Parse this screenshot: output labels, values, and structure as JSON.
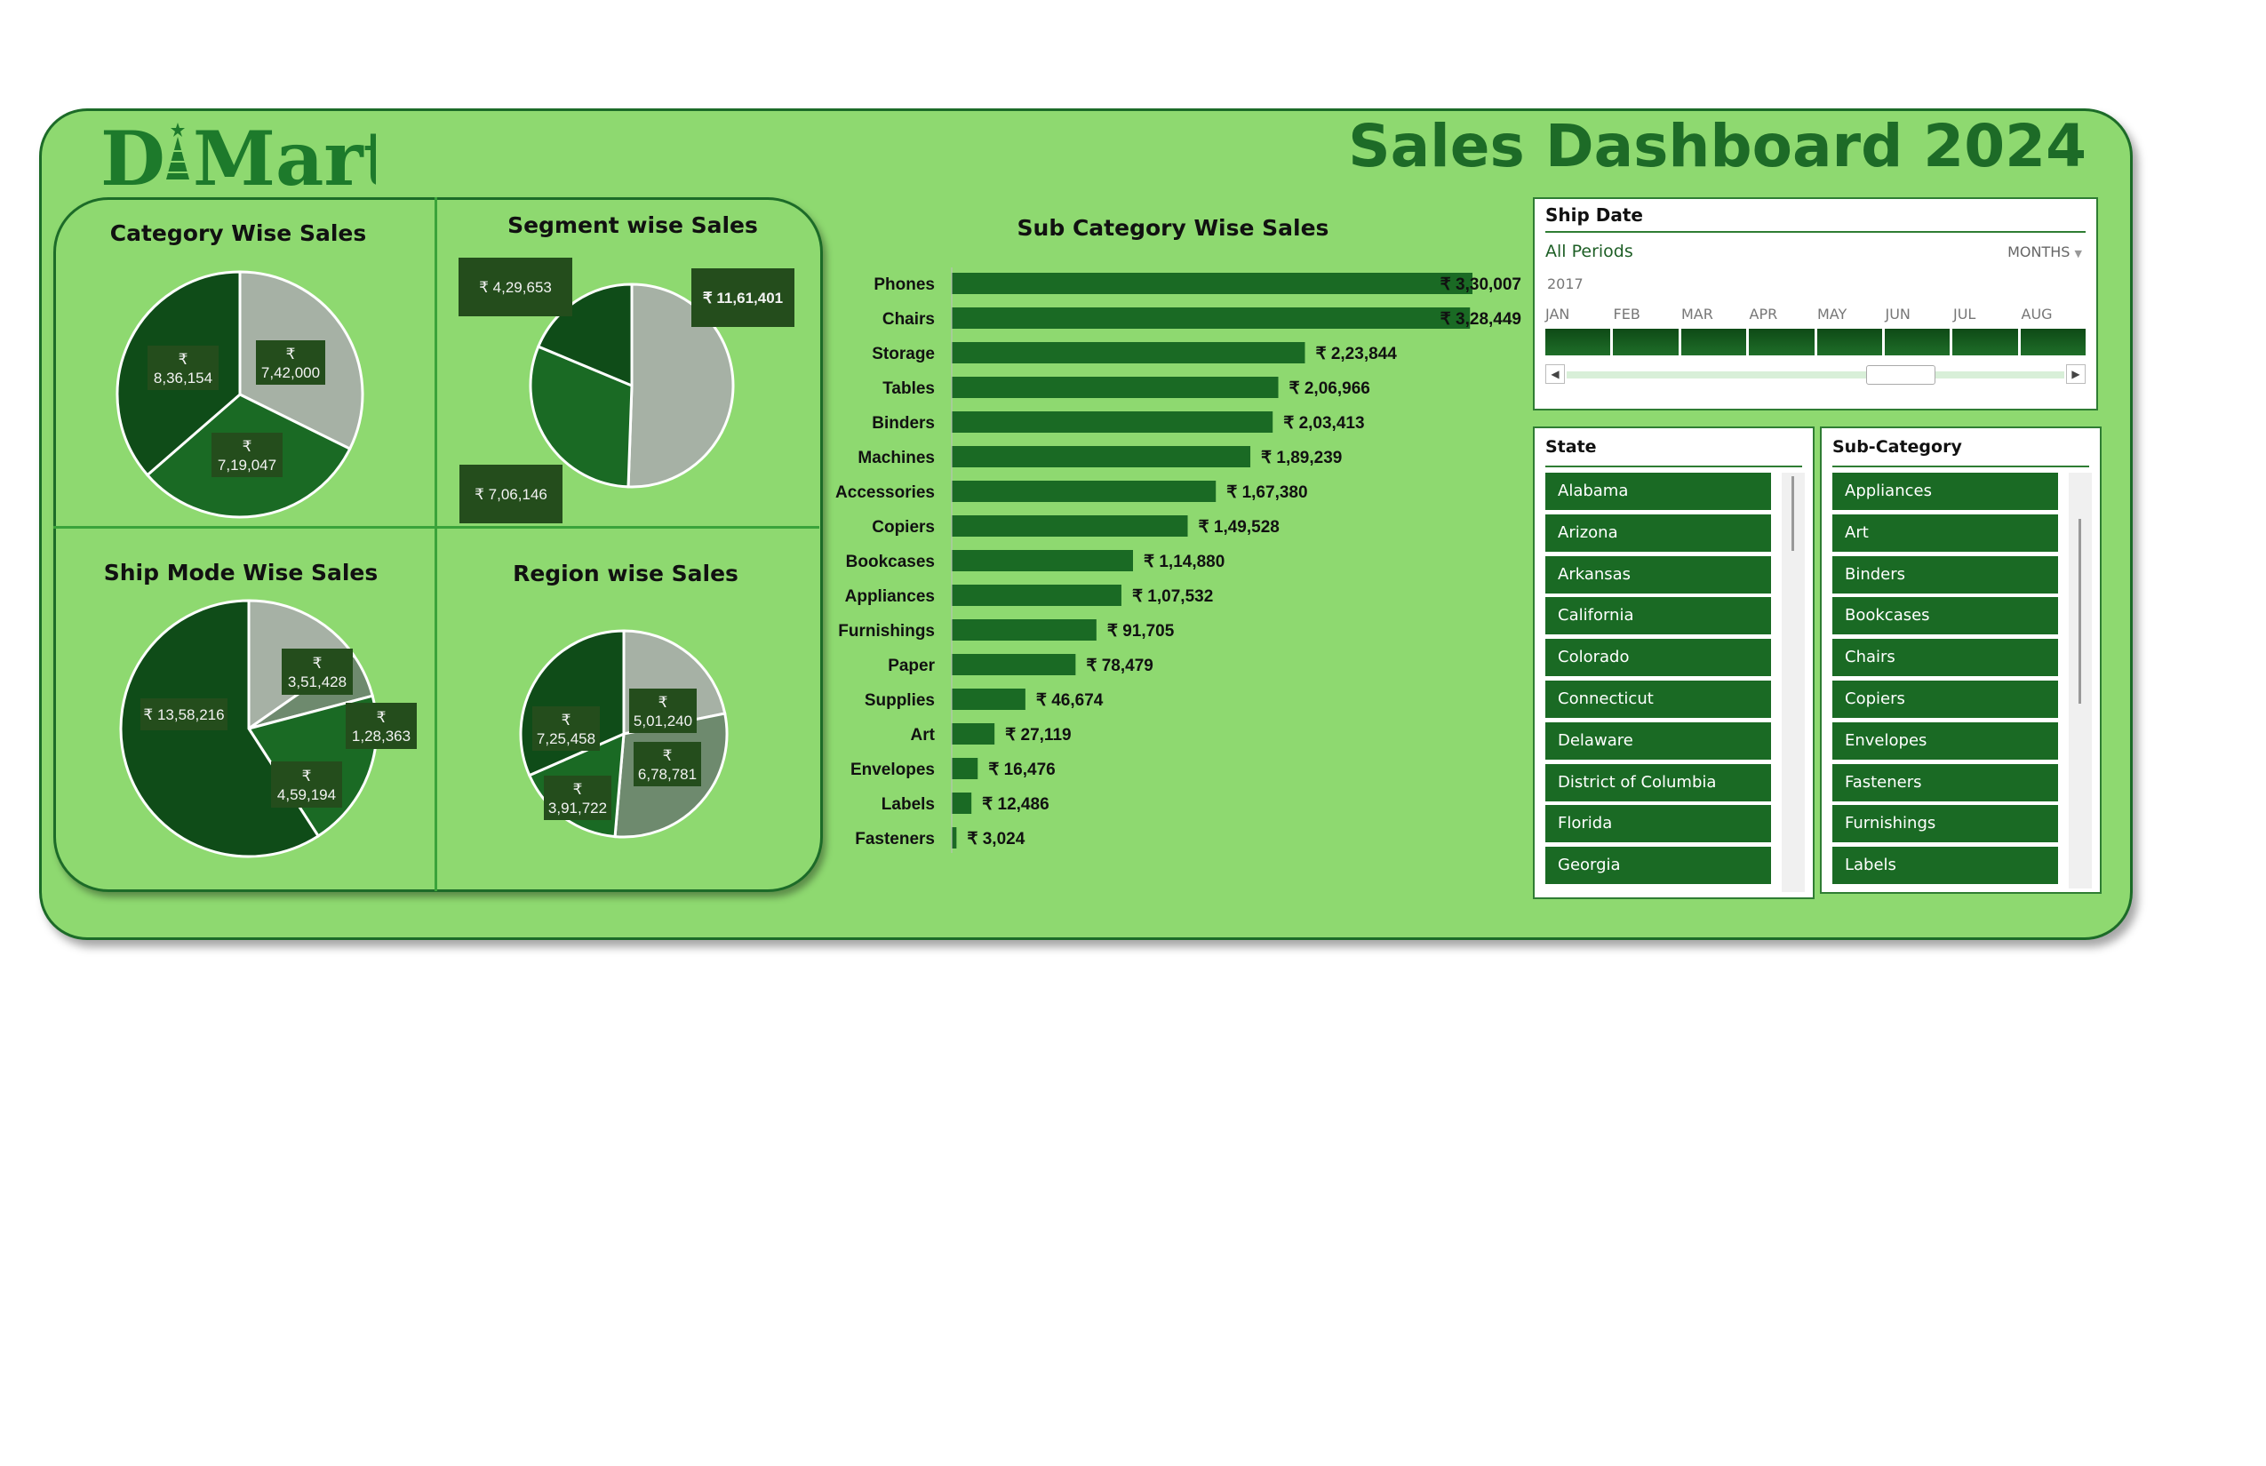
{
  "header": {
    "logo_text": "DMart",
    "title": "Sales Dashboard 2024"
  },
  "colors": {
    "background": "#8ed970",
    "dark_green": "#0f4c18",
    "mid_green": "#1a6a24",
    "grey_green": "#6e8a6e",
    "light_grey": "#a6b1a5",
    "label_box": "#244d1c"
  },
  "panels": {
    "category": "Category Wise Sales",
    "segment": "Segment wise Sales",
    "shipmode": "Ship Mode Wise Sales",
    "region": "Region wise Sales",
    "subcategory": "Sub Category Wise Sales"
  },
  "chart_data": [
    {
      "id": "category",
      "type": "pie",
      "title": "Category Wise Sales",
      "slices": [
        {
          "value": 742000,
          "label_top": "₹",
          "label_bottom": "7,42,000",
          "color": "#a6b1a5"
        },
        {
          "value": 719047,
          "label_top": "₹",
          "label_bottom": "7,19,047",
          "color": "#1a6a24"
        },
        {
          "value": 836154,
          "label_top": "₹",
          "label_bottom": "8,36,154",
          "color": "#0f4c18"
        }
      ]
    },
    {
      "id": "segment",
      "type": "pie",
      "title": "Segment wise Sales",
      "slices": [
        {
          "value": 1161401,
          "label": "₹ 11,61,401",
          "color": "#a6b1a5"
        },
        {
          "value": 706146,
          "label": "₹ 7,06,146",
          "color": "#1a6a24"
        },
        {
          "value": 429653,
          "label": "₹ 4,29,653",
          "color": "#0f4c18"
        }
      ]
    },
    {
      "id": "shipmode",
      "type": "pie",
      "title": "Ship Mode Wise Sales",
      "slices": [
        {
          "value": 351428,
          "label_top": "₹",
          "label_bottom": "3,51,428",
          "color": "#a6b1a5"
        },
        {
          "value": 128363,
          "label_top": "₹",
          "label_bottom": "1,28,363",
          "color": "#6e8a6e"
        },
        {
          "value": 459194,
          "label_top": "₹",
          "label_bottom": "4,59,194",
          "color": "#1a6a24"
        },
        {
          "value": 1358216,
          "label_top": "",
          "label_bottom": "₹ 13,58,216",
          "color": "#0f4c18"
        }
      ]
    },
    {
      "id": "region",
      "type": "pie",
      "title": "Region wise Sales",
      "slices": [
        {
          "value": 501240,
          "label_top": "₹",
          "label_bottom": "5,01,240",
          "color": "#a6b1a5"
        },
        {
          "value": 678781,
          "label_top": "₹",
          "label_bottom": "6,78,781",
          "color": "#6e8a6e"
        },
        {
          "value": 391722,
          "label_top": "₹",
          "label_bottom": "3,91,722",
          "color": "#1a6a24"
        },
        {
          "value": 725458,
          "label_top": "₹",
          "label_bottom": "7,25,458",
          "color": "#0f4c18"
        }
      ]
    },
    {
      "id": "subcategory",
      "type": "bar",
      "title": "Sub Category Wise Sales",
      "orientation": "horizontal",
      "categories": [
        "Phones",
        "Chairs",
        "Storage",
        "Tables",
        "Binders",
        "Machines",
        "Accessories",
        "Copiers",
        "Bookcases",
        "Appliances",
        "Furnishings",
        "Paper",
        "Supplies",
        "Art",
        "Envelopes",
        "Labels",
        "Fasteners"
      ],
      "values": [
        330007,
        328449,
        223844,
        206966,
        203413,
        189239,
        167380,
        149528,
        114880,
        107532,
        91705,
        78479,
        46674,
        27119,
        16476,
        12486,
        3024
      ],
      "value_labels": [
        "₹ 3,30,007",
        "₹ 3,28,449",
        "₹ 2,23,844",
        "₹ 2,06,966",
        "₹ 2,03,413",
        "₹ 1,89,239",
        "₹ 1,67,380",
        "₹ 1,49,528",
        "₹ 1,14,880",
        "₹ 1,07,532",
        "₹ 91,705",
        "₹ 78,479",
        "₹ 46,674",
        "₹ 27,119",
        "₹ 16,476",
        "₹ 12,486",
        "₹ 3,024"
      ]
    }
  ],
  "timeline": {
    "title": "Ship Date",
    "period": "All Periods",
    "mode": "MONTHS",
    "mode_icon": "dropdown-arrow-icon",
    "year": "2017",
    "months": [
      "JAN",
      "FEB",
      "MAR",
      "APR",
      "MAY",
      "JUN",
      "JUL",
      "AUG"
    ]
  },
  "state_slicer": {
    "title": "State",
    "items": [
      "Alabama",
      "Arizona",
      "Arkansas",
      "California",
      "Colorado",
      "Connecticut",
      "Delaware",
      "District of Columbia",
      "Florida",
      "Georgia"
    ]
  },
  "subcategory_slicer": {
    "title": "Sub-Category",
    "items": [
      "Appliances",
      "Art",
      "Binders",
      "Bookcases",
      "Chairs",
      "Copiers",
      "Envelopes",
      "Fasteners",
      "Furnishings",
      "Labels"
    ]
  }
}
